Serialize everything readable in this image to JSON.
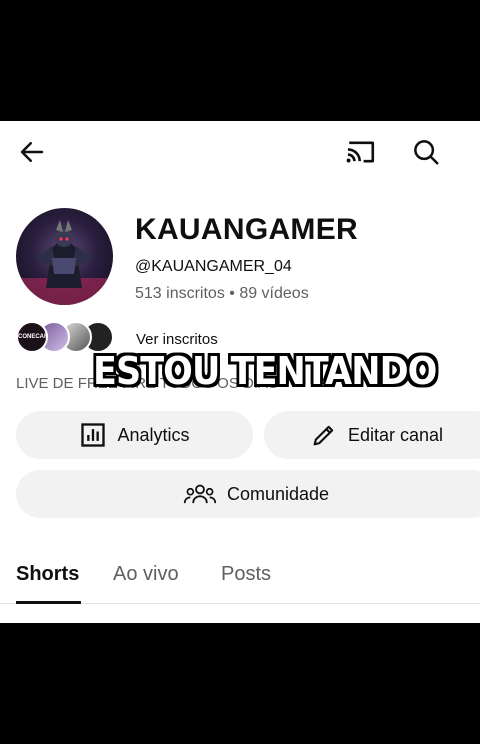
{
  "header": {
    "back_icon": "arrow-left-icon",
    "cast_icon": "cast-icon",
    "search_icon": "search-icon"
  },
  "channel": {
    "name": "KAUANGAMER",
    "handle": "@KAUANGAMER_04",
    "stats": "513 inscritos • 89 vídeos",
    "subscribers_link": "Ver inscritos",
    "mini_avatar_text": "CONECAR",
    "description": "LIVE DE FREE FIRE TODOS OS DIAS"
  },
  "overlay_caption": "ESTOU TENTANDO",
  "actions": {
    "analytics_label": "Analytics",
    "edit_label": "Editar canal",
    "community_label": "Comunidade"
  },
  "tabs": [
    {
      "label": "Shorts",
      "active": true
    },
    {
      "label": "Ao vivo",
      "active": false
    },
    {
      "label": "Posts",
      "active": false
    }
  ],
  "colors": {
    "text_primary": "#0f0f0f",
    "text_secondary": "#606060",
    "pill_bg": "#f2f2f2"
  }
}
